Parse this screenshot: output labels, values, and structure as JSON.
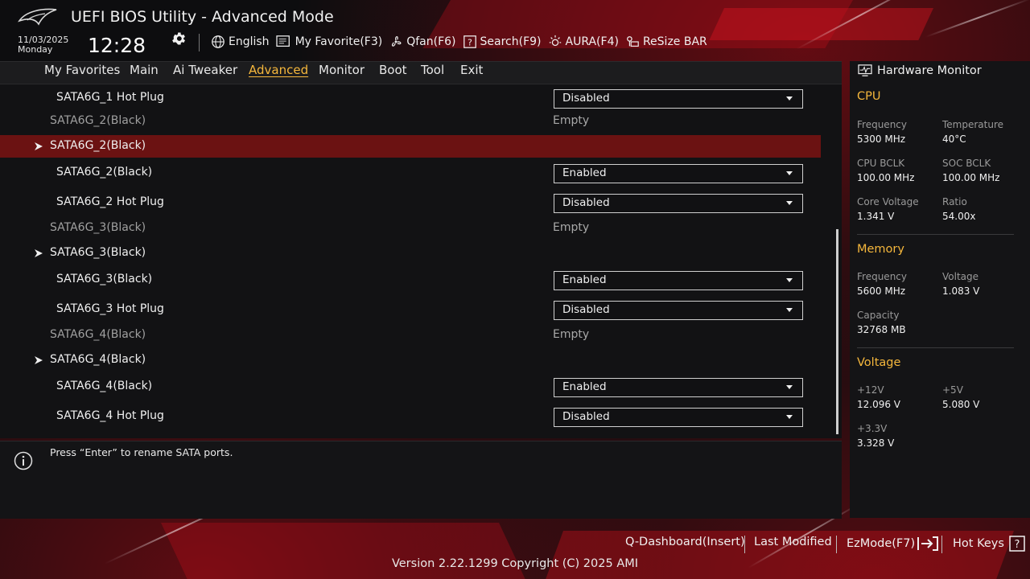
{
  "header": {
    "title": "UEFI BIOS Utility - Advanced Mode",
    "date": "11/03/2025",
    "weekday": "Monday",
    "time": "12:28",
    "toolbar": [
      {
        "label": "English",
        "icon": "globe-icon"
      },
      {
        "label": "My Favorite(F3)",
        "icon": "favorite-list-icon"
      },
      {
        "label": "Qfan(F6)",
        "icon": "fan-icon"
      },
      {
        "label": "Search(F9)",
        "icon": "search-icon"
      },
      {
        "label": "AURA(F4)",
        "icon": "aura-icon"
      },
      {
        "label": "ReSize BAR",
        "icon": "resize-bar-icon"
      }
    ]
  },
  "nav": {
    "tabs": [
      "My Favorites",
      "Main",
      "Ai Tweaker",
      "Advanced",
      "Monitor",
      "Boot",
      "Tool",
      "Exit"
    ],
    "active": "Advanced"
  },
  "settings": {
    "rows": [
      {
        "label": "SATA6G_1 Hot Plug",
        "value": "Disabled"
      },
      {
        "label": "SATA6G_2(Black)",
        "value": "Empty"
      },
      {
        "label": "SATA6G_2(Black)"
      },
      {
        "label": "SATA6G_2(Black)",
        "value": "Enabled"
      },
      {
        "label": "SATA6G_2 Hot Plug",
        "value": "Disabled"
      },
      {
        "label": "SATA6G_3(Black)",
        "value": "Empty"
      },
      {
        "label": "SATA6G_3(Black)"
      },
      {
        "label": "SATA6G_3(Black)",
        "value": "Enabled"
      },
      {
        "label": "SATA6G_3 Hot Plug",
        "value": "Disabled"
      },
      {
        "label": "SATA6G_4(Black)",
        "value": "Empty"
      },
      {
        "label": "SATA6G_4(Black)"
      },
      {
        "label": "SATA6G_4(Black)",
        "value": "Enabled"
      },
      {
        "label": "SATA6G_4 Hot Plug",
        "value": "Disabled"
      }
    ]
  },
  "help": {
    "text": "Press “Enter” to rename SATA ports."
  },
  "hw_monitor": {
    "title": "Hardware Monitor",
    "cpu": {
      "heading": "CPU",
      "frequency_label": "Frequency",
      "frequency": "5300 MHz",
      "temperature_label": "Temperature",
      "temperature": "40°C",
      "cpu_bclk_label": "CPU BCLK",
      "cpu_bclk": "100.00 MHz",
      "soc_bclk_label": "SOC BCLK",
      "soc_bclk": "100.00 MHz",
      "core_voltage_label": "Core Voltage",
      "core_voltage": "1.341 V",
      "ratio_label": "Ratio",
      "ratio": "54.00x"
    },
    "memory": {
      "heading": "Memory",
      "frequency_label": "Frequency",
      "frequency": "5600 MHz",
      "voltage_label": "Voltage",
      "voltage": "1.083 V",
      "capacity_label": "Capacity",
      "capacity": "32768 MB"
    },
    "voltage": {
      "heading": "Voltage",
      "v12_label": "+12V",
      "v12": "12.096 V",
      "v5_label": "+5V",
      "v5": "5.080 V",
      "v33_label": "+3.3V",
      "v33": "3.328 V"
    }
  },
  "footer": {
    "q_dashboard": "Q-Dashboard(Insert)",
    "last_modified": "Last Modified",
    "ezmode": "EzMode(F7)",
    "hot_keys": "Hot Keys",
    "version": "Version 2.22.1299 Copyright (C) 2025 AMI"
  },
  "colors": {
    "accent": "#f5b73c",
    "selected_row": "#6b1212",
    "brand_red": "#be0f19"
  }
}
